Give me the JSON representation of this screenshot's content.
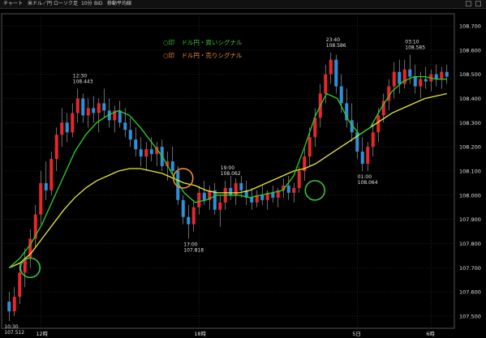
{
  "window": {
    "tabs": [
      "チャート",
      "米ドル／円",
      "ローソク足",
      "10分",
      "BID",
      "移動平均線"
    ]
  },
  "legend": {
    "buy_mark": "○印",
    "buy_text": "ドル円・買いシグナル",
    "sell_mark": "○印",
    "sell_text": "ドル円・売りシグナル"
  },
  "colors": {
    "background": "#000000",
    "grid": "#3a3a3a",
    "candle_up": "#e8262d",
    "candle_down": "#2f8fd8",
    "ma_short": "#2bd12b",
    "ma_long": "#e8e83a",
    "buy_circle": "#3ac43a",
    "sell_circle": "#f08a3a",
    "text": "#e0e0e0"
  },
  "chart_data": {
    "type": "candlestick",
    "title": "",
    "instrument": "米ドル／円",
    "timeframe": "10分",
    "price_type": "BID",
    "ylim": [
      107.45,
      108.75
    ],
    "y_ticks": [
      "108.700",
      "108.600",
      "108.500",
      "108.400",
      "108.300",
      "108.200",
      "108.100",
      "108.000",
      "107.900",
      "107.800",
      "107.700",
      "107.600",
      "107.500"
    ],
    "x_ticks": [
      "12時",
      "18時",
      "5日",
      "6時"
    ],
    "candles_ohlc": [
      [
        107.56,
        107.6,
        107.48,
        107.52
      ],
      [
        107.52,
        107.62,
        107.5,
        107.58
      ],
      [
        107.58,
        107.72,
        107.55,
        107.68
      ],
      [
        107.68,
        107.78,
        107.62,
        107.74
      ],
      [
        107.74,
        107.86,
        107.7,
        107.82
      ],
      [
        107.82,
        107.96,
        107.78,
        107.92
      ],
      [
        107.92,
        108.1,
        107.88,
        108.05
      ],
      [
        108.05,
        108.14,
        107.98,
        108.02
      ],
      [
        108.02,
        108.18,
        108.0,
        108.15
      ],
      [
        108.15,
        108.28,
        108.1,
        108.25
      ],
      [
        108.25,
        108.36,
        108.2,
        108.3
      ],
      [
        108.3,
        108.34,
        108.22,
        108.26
      ],
      [
        108.26,
        108.38,
        108.24,
        108.34
      ],
      [
        108.34,
        108.44,
        108.3,
        108.4
      ],
      [
        108.4,
        108.42,
        108.3,
        108.33
      ],
      [
        108.33,
        108.4,
        108.28,
        108.36
      ],
      [
        108.36,
        108.41,
        108.3,
        108.34
      ],
      [
        108.34,
        108.4,
        108.26,
        108.38
      ],
      [
        108.38,
        108.44,
        108.32,
        108.35
      ],
      [
        108.35,
        108.4,
        108.28,
        108.31
      ],
      [
        108.31,
        108.37,
        108.26,
        108.35
      ],
      [
        108.35,
        108.39,
        108.28,
        108.3
      ],
      [
        108.3,
        108.36,
        108.24,
        108.27
      ],
      [
        108.27,
        108.32,
        108.2,
        108.23
      ],
      [
        108.23,
        108.28,
        108.16,
        108.19
      ],
      [
        108.19,
        108.24,
        108.12,
        108.16
      ],
      [
        108.16,
        108.22,
        108.1,
        108.19
      ],
      [
        108.19,
        108.24,
        108.14,
        108.17
      ],
      [
        108.17,
        108.22,
        108.12,
        108.2
      ],
      [
        108.2,
        108.23,
        108.1,
        108.12
      ],
      [
        108.12,
        108.18,
        108.06,
        108.14
      ],
      [
        108.14,
        108.2,
        108.08,
        108.1
      ],
      [
        108.1,
        108.12,
        107.96,
        107.98
      ],
      [
        107.98,
        108.0,
        107.88,
        107.91
      ],
      [
        107.91,
        107.96,
        107.82,
        107.88
      ],
      [
        107.88,
        107.98,
        107.85,
        107.95
      ],
      [
        107.95,
        108.04,
        107.92,
        108.01
      ],
      [
        108.01,
        108.06,
        107.96,
        107.98
      ],
      [
        107.98,
        108.04,
        107.94,
        108.02
      ],
      [
        108.02,
        108.05,
        107.92,
        107.94
      ],
      [
        107.94,
        108.0,
        107.87,
        107.97
      ],
      [
        107.97,
        108.06,
        107.94,
        108.03
      ],
      [
        108.03,
        108.08,
        107.98,
        108.0
      ],
      [
        108.0,
        108.07,
        107.96,
        108.05
      ],
      [
        108.05,
        108.08,
        107.99,
        108.02
      ],
      [
        108.02,
        108.06,
        107.96,
        107.99
      ],
      [
        107.99,
        108.03,
        107.94,
        107.97
      ],
      [
        107.97,
        108.02,
        107.95,
        108.0
      ],
      [
        108.0,
        108.04,
        107.96,
        107.98
      ],
      [
        107.98,
        108.02,
        107.94,
        108.01
      ],
      [
        108.01,
        108.04,
        107.97,
        107.99
      ],
      [
        107.99,
        108.03,
        107.95,
        108.02
      ],
      [
        108.02,
        108.07,
        107.99,
        108.04
      ],
      [
        108.04,
        108.08,
        107.98,
        108.01
      ],
      [
        108.01,
        108.05,
        107.97,
        108.03
      ],
      [
        108.03,
        108.12,
        108.01,
        108.1
      ],
      [
        108.1,
        108.2,
        108.06,
        108.16
      ],
      [
        108.16,
        108.28,
        108.12,
        108.24
      ],
      [
        108.24,
        108.36,
        108.2,
        108.32
      ],
      [
        108.32,
        108.46,
        108.28,
        108.42
      ],
      [
        108.42,
        108.54,
        108.38,
        108.5
      ],
      [
        108.5,
        108.59,
        108.46,
        108.56
      ],
      [
        108.56,
        108.58,
        108.42,
        108.45
      ],
      [
        108.45,
        108.5,
        108.34,
        108.38
      ],
      [
        108.38,
        108.44,
        108.28,
        108.31
      ],
      [
        108.31,
        108.38,
        108.22,
        108.26
      ],
      [
        108.26,
        108.3,
        108.15,
        108.18
      ],
      [
        108.18,
        108.24,
        108.1,
        108.13
      ],
      [
        108.13,
        108.22,
        108.1,
        108.2
      ],
      [
        108.2,
        108.3,
        108.16,
        108.26
      ],
      [
        108.26,
        108.36,
        108.22,
        108.33
      ],
      [
        108.33,
        108.42,
        108.3,
        108.39
      ],
      [
        108.39,
        108.48,
        108.35,
        108.45
      ],
      [
        108.45,
        108.55,
        108.4,
        108.51
      ],
      [
        108.51,
        108.56,
        108.42,
        108.46
      ],
      [
        108.46,
        108.56,
        108.44,
        108.52
      ],
      [
        108.52,
        108.58,
        108.46,
        108.49
      ],
      [
        108.49,
        108.54,
        108.42,
        108.45
      ],
      [
        108.45,
        108.51,
        108.4,
        108.48
      ],
      [
        108.48,
        108.53,
        108.44,
        108.47
      ],
      [
        108.47,
        108.52,
        108.43,
        108.5
      ],
      [
        108.5,
        108.54,
        108.45,
        108.48
      ],
      [
        108.48,
        108.53,
        108.44,
        108.51
      ],
      [
        108.51,
        108.54,
        108.46,
        108.49
      ]
    ],
    "ma_short": [
      107.7,
      107.74,
      107.8,
      107.88,
      107.98,
      108.08,
      108.18,
      108.25,
      108.3,
      108.33,
      108.35,
      108.33,
      108.28,
      108.22,
      108.16,
      108.08,
      108.01,
      107.97,
      107.98,
      108.0,
      108.0,
      108.0,
      107.99,
      108.0,
      108.01,
      108.02,
      108.08,
      108.2,
      108.33,
      108.42,
      108.4,
      108.31,
      108.25,
      108.28,
      108.36,
      108.43,
      108.47,
      108.49,
      108.49,
      108.48,
      108.48
    ],
    "ma_long": [
      107.7,
      107.72,
      107.76,
      107.82,
      107.88,
      107.94,
      107.99,
      108.03,
      108.06,
      108.08,
      108.1,
      108.11,
      108.11,
      108.1,
      108.09,
      108.07,
      108.05,
      108.04,
      108.02,
      108.01,
      108.01,
      108.01,
      108.02,
      108.04,
      108.06,
      108.08,
      108.1,
      108.11,
      108.13,
      108.16,
      108.19,
      108.22,
      108.25,
      108.28,
      108.31,
      108.34,
      108.36,
      108.38,
      108.4,
      108.41,
      108.42
    ],
    "annotations": [
      {
        "time": "10:30",
        "price": "107.512",
        "candle": 0,
        "side": "low"
      },
      {
        "time": "12:30",
        "price": "108.443",
        "candle": 13,
        "side": "high"
      },
      {
        "time": "17:00",
        "price": "107.818",
        "candle": 34,
        "side": "low"
      },
      {
        "time": "19:00",
        "price": "108.062",
        "candle": 41,
        "side": "high"
      },
      {
        "time": "01:00",
        "price": "108.064",
        "candle": 67,
        "side": "low"
      },
      {
        "time": "23:40",
        "price": "108.586",
        "candle": 61,
        "side": "high"
      },
      {
        "time": "03:10",
        "price": "108.585",
        "candle": 76,
        "side": "high"
      }
    ],
    "signals": [
      {
        "type": "buy",
        "candle": 4,
        "price": 107.7
      },
      {
        "type": "sell",
        "candle": 33,
        "price": 108.07
      },
      {
        "type": "buy",
        "candle": 58,
        "price": 108.02
      }
    ]
  }
}
